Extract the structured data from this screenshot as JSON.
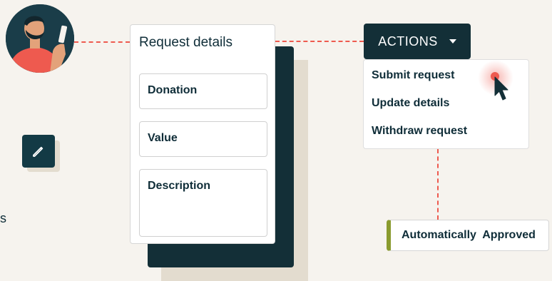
{
  "form": {
    "title": "Request details",
    "fields": [
      {
        "label": "Donation"
      },
      {
        "label": "Value"
      },
      {
        "label": "Description"
      }
    ]
  },
  "actions": {
    "label": "ACTIONS",
    "menu": [
      {
        "label": "Submit request"
      },
      {
        "label": "Update details"
      },
      {
        "label": "Withdraw request"
      }
    ]
  },
  "status": {
    "label": "Automatically  Approved",
    "accent": "#8a9b2e"
  },
  "side_text": "s",
  "icons": [
    "avatar",
    "pencil-icon",
    "caret-down-icon",
    "mouse-cursor-icon"
  ],
  "colors": {
    "background": "#f6f3ee",
    "dark": "#132f37",
    "connector": "#ee5a4f"
  }
}
